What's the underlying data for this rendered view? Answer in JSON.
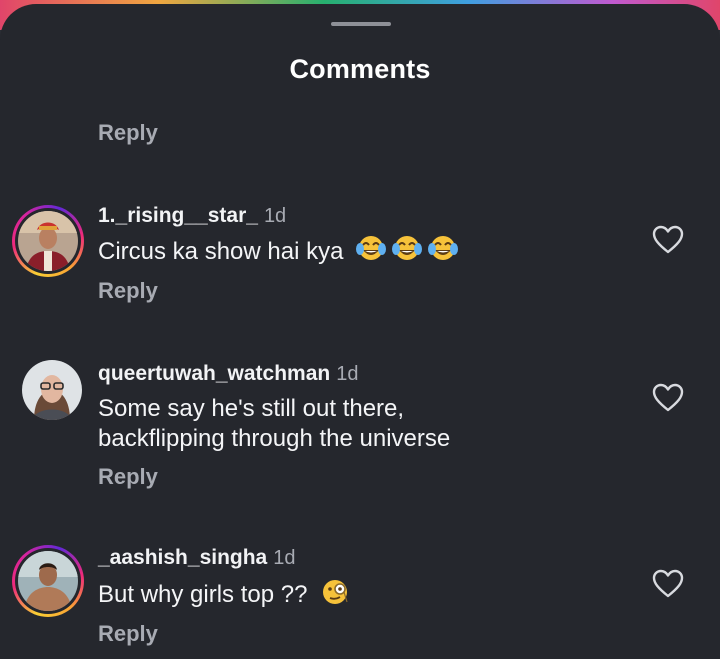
{
  "header": {
    "title": "Comments"
  },
  "top_reply": {
    "label": "Reply"
  },
  "comments": [
    {
      "username": "1._rising__star_",
      "time": "1d",
      "text": "Circus ka show hai kya",
      "emoji": [
        "face-with-tears-of-joy",
        "face-with-tears-of-joy",
        "face-with-tears-of-joy"
      ],
      "reply_label": "Reply",
      "avatar_story_ring": true,
      "like_icon": "heart-outline-icon"
    },
    {
      "username": "queertuwah_watchman",
      "time": "1d",
      "text_lines": [
        "Some say he's still out there,",
        "backflipping through the universe"
      ],
      "reply_label": "Reply",
      "avatar_story_ring": false,
      "like_icon": "heart-outline-icon"
    },
    {
      "username": "_aashish_singha",
      "time": "1d",
      "text": "But why girls top ??",
      "emoji": [
        "face-with-monocle"
      ],
      "reply_label": "Reply",
      "avatar_story_ring": true,
      "like_icon": "heart-outline-icon"
    }
  ],
  "colors": {
    "background": "#25272d",
    "primary_text": "#f4f5f7",
    "secondary_text": "#a8abb3"
  }
}
